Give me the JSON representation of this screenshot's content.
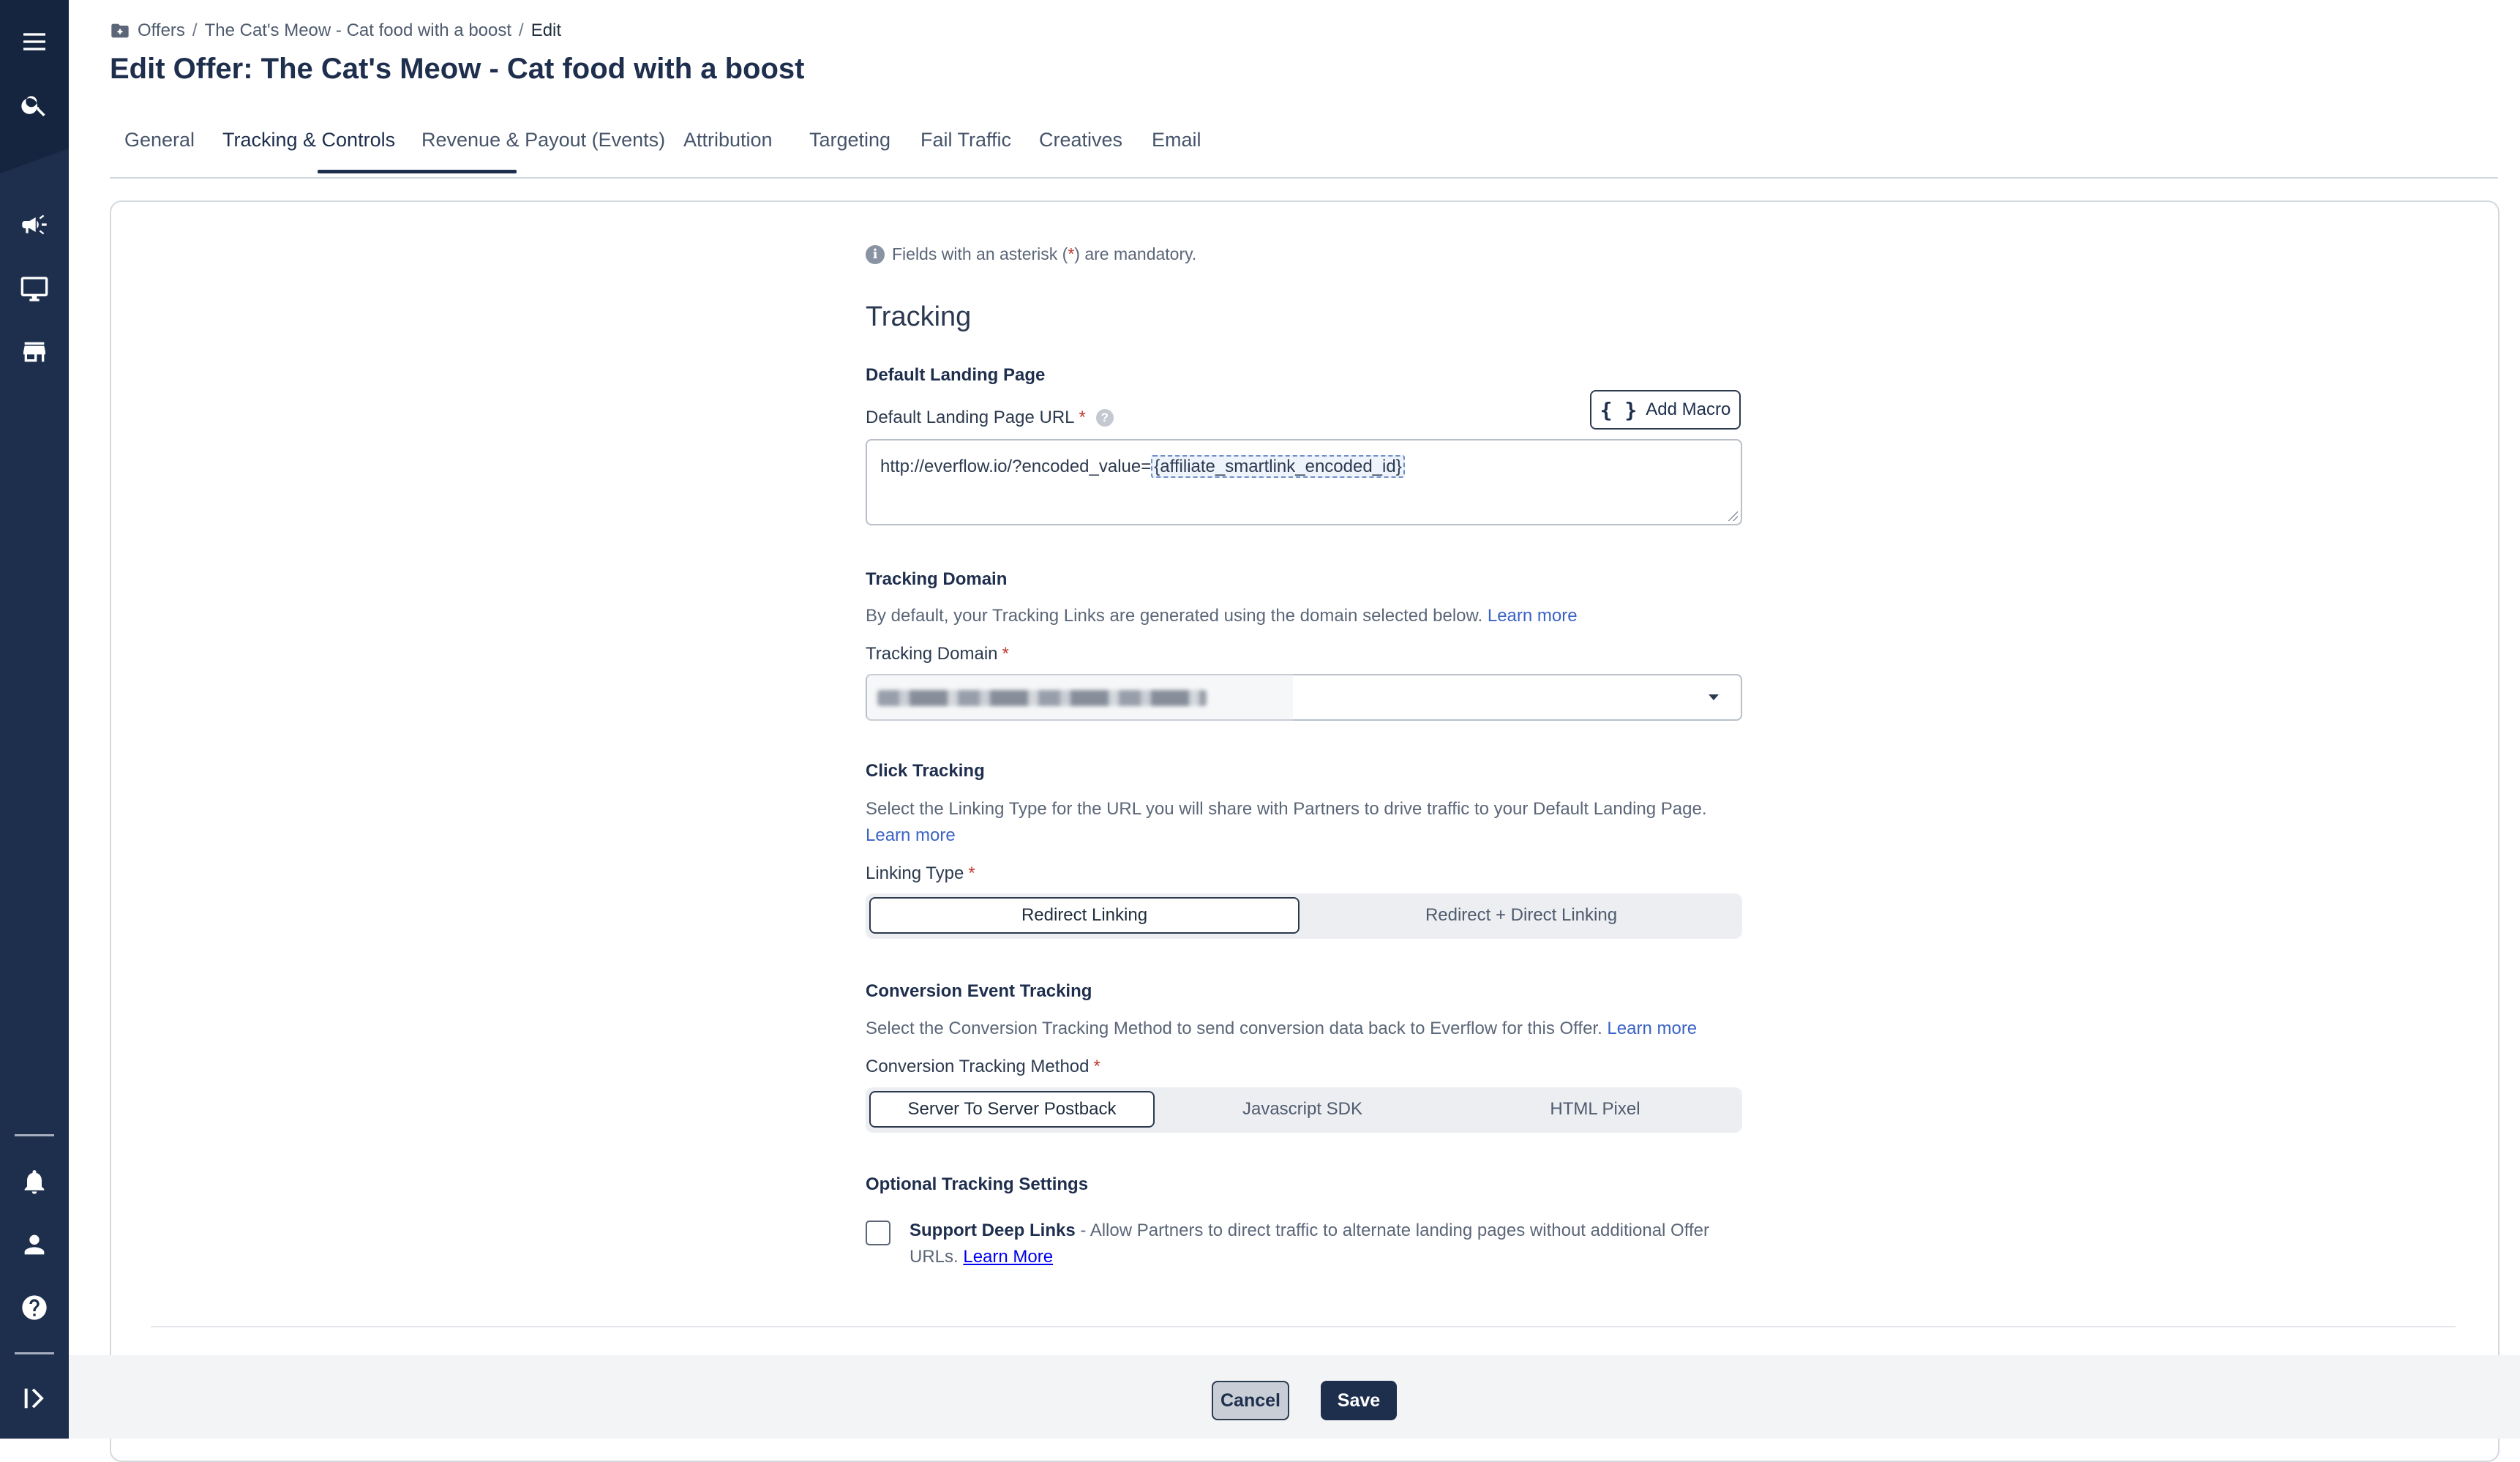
{
  "breadcrumb": {
    "items": [
      "Offers",
      "The Cat's Meow - Cat food with a boost",
      "Edit"
    ],
    "separator": "/"
  },
  "page_title": "Edit Offer: The Cat's Meow - Cat food with a boost",
  "tabs": [
    {
      "label": "General",
      "active": false
    },
    {
      "label": "Tracking & Controls",
      "active": true
    },
    {
      "label": "Revenue & Payout (Events)",
      "active": false
    },
    {
      "label": "Attribution",
      "active": false
    },
    {
      "label": "Targeting",
      "active": false
    },
    {
      "label": "Fail Traffic",
      "active": false
    },
    {
      "label": "Creatives",
      "active": false
    },
    {
      "label": "Email",
      "active": false
    }
  ],
  "form": {
    "mandatory_note_prefix": "Fields with an asterisk (",
    "mandatory_note_star": "*",
    "mandatory_note_suffix": ") are mandatory.",
    "section_title": "Tracking",
    "landing": {
      "heading": "Default Landing Page",
      "url_label": "Default Landing Page URL",
      "required": "*",
      "add_macro_label": "Add Macro",
      "url_value_prefix": "http://everflow.io/?encoded_value=",
      "url_value_macro": "{affiliate_smartlink_encoded_id}"
    },
    "tracking_domain": {
      "heading": "Tracking Domain",
      "help": "By default, your Tracking Links are generated using the domain selected below.",
      "learn_more": "Learn more",
      "label": "Tracking Domain",
      "required": "*"
    },
    "click_tracking": {
      "heading": "Click Tracking",
      "help": "Select the Linking Type for the URL you will share with Partners to drive traffic to your Default Landing Page.",
      "learn_more": "Learn more",
      "label": "Linking Type",
      "required": "*",
      "options": [
        "Redirect Linking",
        "Redirect + Direct Linking"
      ],
      "selected": "Redirect Linking"
    },
    "conversion": {
      "heading": "Conversion Event Tracking",
      "help": "Select the Conversion Tracking Method to send conversion data back to Everflow for this Offer.",
      "learn_more": "Learn more",
      "label": "Conversion Tracking Method",
      "required": "*",
      "options": [
        "Server To Server Postback",
        "Javascript SDK",
        "HTML Pixel"
      ],
      "selected": "Server To Server Postback"
    },
    "optional": {
      "heading": "Optional Tracking Settings",
      "deep_links_title": "Support Deep Links",
      "deep_links_desc": " - Allow Partners to direct traffic to alternate landing pages without additional Offer URLs.",
      "learn_more": "Learn More",
      "checked": false
    }
  },
  "footer": {
    "cancel_label": "Cancel",
    "save_label": "Save"
  },
  "icons": {
    "rail": [
      "menu-icon",
      "search-icon",
      "megaphone-icon",
      "monitor-icon",
      "storefront-icon",
      "bell-icon",
      "user-icon",
      "help-icon",
      "expand-sidebar-icon"
    ]
  },
  "colors": {
    "sidebar": "#1d2f4d",
    "primary": "#1e2e4d",
    "link": "#3a63c5",
    "required": "#c0392b"
  }
}
